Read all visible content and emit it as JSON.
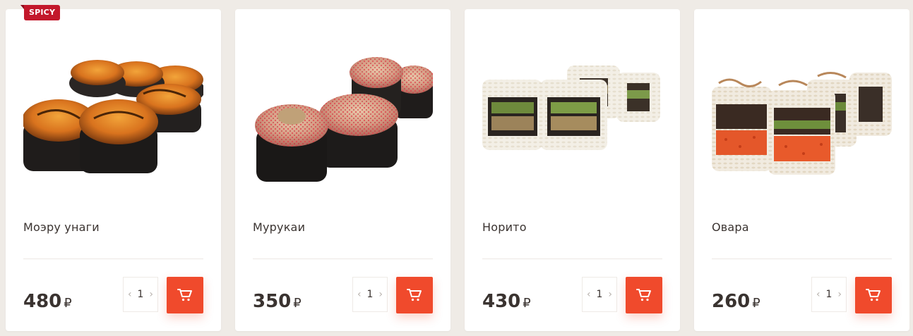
{
  "products": [
    {
      "badge": "SPICY",
      "name": "Моэру унаги",
      "price": "480",
      "currency": "₽",
      "quantity": "1",
      "image_icon": "baked-sushi-roll-image"
    },
    {
      "badge": "",
      "name": "Мурукаи",
      "price": "350",
      "currency": "₽",
      "quantity": "1",
      "image_icon": "baked-sushi-roll-image"
    },
    {
      "badge": "",
      "name": "Норито",
      "price": "430",
      "currency": "₽",
      "quantity": "1",
      "image_icon": "uramaki-roll-image"
    },
    {
      "badge": "",
      "name": "Овара",
      "price": "260",
      "currency": "₽",
      "quantity": "1",
      "image_icon": "uramaki-roll-image"
    }
  ],
  "colors": {
    "page_background": "#efebe6",
    "card_background": "#ffffff",
    "accent": "#f04a2c",
    "badge": "#c3182b",
    "text": "#3a3330"
  },
  "icons": {
    "decrement": "chevron-left-icon",
    "increment": "chevron-right-icon",
    "cart": "cart-icon"
  }
}
